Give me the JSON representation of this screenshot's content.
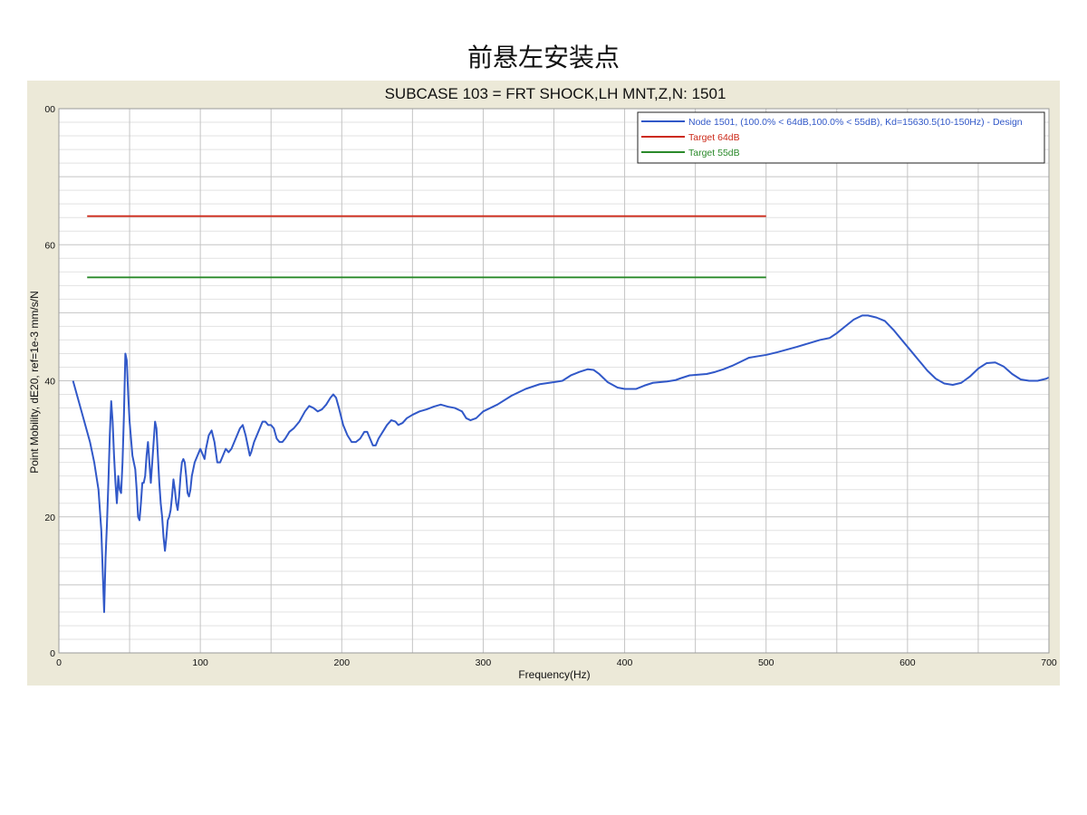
{
  "page": {
    "title": "前悬左安装点"
  },
  "chart_data": {
    "type": "line",
    "title": "SUBCASE 103 = FRT SHOCK,LH MNT,Z,N: 1501",
    "xlabel": "Frequency(Hz)",
    "ylabel": "Point Mobility, dE20, ref=1e-3 mm/s/N",
    "xlim": [
      0,
      700
    ],
    "ylim": [
      0,
      80
    ],
    "x_ticks": [
      "0",
      "100",
      "200",
      "300",
      "400",
      "500",
      "600",
      "700"
    ],
    "y_ticks": [
      "0",
      "20",
      "40",
      "60",
      "00"
    ],
    "grid": true,
    "legend_position": "top-right",
    "colors": {
      "node": "#3158c8",
      "target64": "#cc2a1a",
      "target55": "#2a8a2a",
      "panel": "#ece9d8"
    },
    "series": [
      {
        "name": "Node 1501, (100.0% < 64dB,100.0% < 55dB), Kd=15630.5(10-150Hz) - Design",
        "color": "#3158c8",
        "points": [
          [
            10,
            40
          ],
          [
            14,
            37
          ],
          [
            18,
            34
          ],
          [
            22,
            31
          ],
          [
            25,
            28
          ],
          [
            28,
            24
          ],
          [
            30,
            18
          ],
          [
            31,
            12
          ],
          [
            32,
            6
          ],
          [
            33,
            14
          ],
          [
            34,
            19
          ],
          [
            35,
            25
          ],
          [
            36,
            32
          ],
          [
            37,
            37
          ],
          [
            38,
            34
          ],
          [
            39,
            29
          ],
          [
            40,
            25
          ],
          [
            41,
            22
          ],
          [
            42,
            26
          ],
          [
            43,
            24
          ],
          [
            44,
            23.5
          ],
          [
            45,
            28
          ],
          [
            46,
            35
          ],
          [
            47,
            44
          ],
          [
            48,
            43
          ],
          [
            49,
            38
          ],
          [
            50,
            34
          ],
          [
            52,
            29
          ],
          [
            54,
            27
          ],
          [
            55,
            24
          ],
          [
            56,
            20
          ],
          [
            57,
            19.5
          ],
          [
            58,
            22
          ],
          [
            59,
            25
          ],
          [
            60,
            25
          ],
          [
            61,
            26
          ],
          [
            62,
            29
          ],
          [
            63,
            31
          ],
          [
            64,
            28
          ],
          [
            65,
            25
          ],
          [
            66,
            28
          ],
          [
            67,
            31
          ],
          [
            68,
            34
          ],
          [
            69,
            33
          ],
          [
            70,
            29
          ],
          [
            71,
            25
          ],
          [
            72,
            22
          ],
          [
            73,
            20
          ],
          [
            74,
            17
          ],
          [
            75,
            15
          ],
          [
            76,
            17
          ],
          [
            77,
            19.5
          ],
          [
            78,
            20
          ],
          [
            79,
            21
          ],
          [
            80,
            23
          ],
          [
            81,
            25.5
          ],
          [
            82,
            24
          ],
          [
            83,
            22
          ],
          [
            84,
            21
          ],
          [
            85,
            23
          ],
          [
            86,
            26
          ],
          [
            87,
            28
          ],
          [
            88,
            28.5
          ],
          [
            89,
            28
          ],
          [
            90,
            26
          ],
          [
            91,
            23.5
          ],
          [
            92,
            23
          ],
          [
            93,
            24
          ],
          [
            94,
            26
          ],
          [
            96,
            28
          ],
          [
            98,
            29
          ],
          [
            100,
            30
          ],
          [
            102,
            29
          ],
          [
            103,
            28.5
          ],
          [
            104,
            30
          ],
          [
            106,
            32
          ],
          [
            108,
            32.7
          ],
          [
            110,
            31
          ],
          [
            112,
            28
          ],
          [
            114,
            28
          ],
          [
            116,
            29
          ],
          [
            118,
            30
          ],
          [
            120,
            29.5
          ],
          [
            122,
            30
          ],
          [
            124,
            31
          ],
          [
            126,
            32
          ],
          [
            128,
            33
          ],
          [
            130,
            33.5
          ],
          [
            132,
            32
          ],
          [
            134,
            30
          ],
          [
            135,
            29
          ],
          [
            136,
            29.5
          ],
          [
            138,
            31
          ],
          [
            140,
            32
          ],
          [
            142,
            33
          ],
          [
            144,
            34
          ],
          [
            146,
            34
          ],
          [
            148,
            33.5
          ],
          [
            150,
            33.5
          ],
          [
            152,
            33
          ],
          [
            154,
            31.5
          ],
          [
            156,
            31
          ],
          [
            158,
            31
          ],
          [
            160,
            31.5
          ],
          [
            163,
            32.5
          ],
          [
            166,
            33
          ],
          [
            170,
            34
          ],
          [
            174,
            35.5
          ],
          [
            177,
            36.3
          ],
          [
            180,
            36
          ],
          [
            183,
            35.5
          ],
          [
            186,
            35.8
          ],
          [
            189,
            36.5
          ],
          [
            192,
            37.5
          ],
          [
            194,
            38
          ],
          [
            196,
            37.5
          ],
          [
            198,
            36
          ],
          [
            201,
            33.5
          ],
          [
            204,
            32
          ],
          [
            207,
            31
          ],
          [
            210,
            31
          ],
          [
            213,
            31.5
          ],
          [
            216,
            32.5
          ],
          [
            218,
            32.5
          ],
          [
            220,
            31.5
          ],
          [
            222,
            30.5
          ],
          [
            224,
            30.5
          ],
          [
            226,
            31.5
          ],
          [
            229,
            32.5
          ],
          [
            232,
            33.5
          ],
          [
            235,
            34.2
          ],
          [
            238,
            34
          ],
          [
            240,
            33.5
          ],
          [
            243,
            33.8
          ],
          [
            246,
            34.5
          ],
          [
            250,
            35
          ],
          [
            255,
            35.5
          ],
          [
            260,
            35.8
          ],
          [
            265,
            36.2
          ],
          [
            270,
            36.5
          ],
          [
            275,
            36.2
          ],
          [
            280,
            36
          ],
          [
            285,
            35.5
          ],
          [
            288,
            34.5
          ],
          [
            291,
            34.2
          ],
          [
            295,
            34.5
          ],
          [
            300,
            35.5
          ],
          [
            310,
            36.5
          ],
          [
            320,
            37.8
          ],
          [
            330,
            38.8
          ],
          [
            340,
            39.5
          ],
          [
            350,
            39.8
          ],
          [
            356,
            40
          ],
          [
            362,
            40.8
          ],
          [
            368,
            41.3
          ],
          [
            374,
            41.7
          ],
          [
            378,
            41.6
          ],
          [
            382,
            41
          ],
          [
            388,
            39.8
          ],
          [
            395,
            39
          ],
          [
            400,
            38.8
          ],
          [
            408,
            38.8
          ],
          [
            414,
            39.3
          ],
          [
            420,
            39.7
          ],
          [
            430,
            39.9
          ],
          [
            436,
            40.1
          ],
          [
            440,
            40.4
          ],
          [
            446,
            40.8
          ],
          [
            452,
            40.9
          ],
          [
            458,
            41
          ],
          [
            464,
            41.3
          ],
          [
            470,
            41.7
          ],
          [
            476,
            42.2
          ],
          [
            482,
            42.8
          ],
          [
            488,
            43.4
          ],
          [
            494,
            43.6
          ],
          [
            500,
            43.8
          ],
          [
            508,
            44.2
          ],
          [
            515,
            44.6
          ],
          [
            522,
            45
          ],
          [
            530,
            45.5
          ],
          [
            538,
            46
          ],
          [
            545,
            46.3
          ],
          [
            550,
            47
          ],
          [
            556,
            48
          ],
          [
            562,
            49
          ],
          [
            568,
            49.6
          ],
          [
            572,
            49.6
          ],
          [
            578,
            49.3
          ],
          [
            584,
            48.8
          ],
          [
            590,
            47.5
          ],
          [
            596,
            46
          ],
          [
            602,
            44.5
          ],
          [
            608,
            43
          ],
          [
            614,
            41.5
          ],
          [
            620,
            40.3
          ],
          [
            626,
            39.6
          ],
          [
            632,
            39.4
          ],
          [
            638,
            39.7
          ],
          [
            644,
            40.6
          ],
          [
            650,
            41.8
          ],
          [
            656,
            42.6
          ],
          [
            662,
            42.7
          ],
          [
            668,
            42.1
          ],
          [
            674,
            41
          ],
          [
            680,
            40.2
          ],
          [
            686,
            40
          ],
          [
            692,
            40
          ],
          [
            698,
            40.3
          ],
          [
            700,
            40.5
          ]
        ]
      },
      {
        "name": "Target 64dB",
        "color": "#cc2a1a",
        "points": [
          [
            20,
            64.2
          ],
          [
            500,
            64.2
          ]
        ]
      },
      {
        "name": "Target 55dB",
        "color": "#2a8a2a",
        "points": [
          [
            20,
            55.2
          ],
          [
            500,
            55.2
          ]
        ]
      }
    ]
  }
}
